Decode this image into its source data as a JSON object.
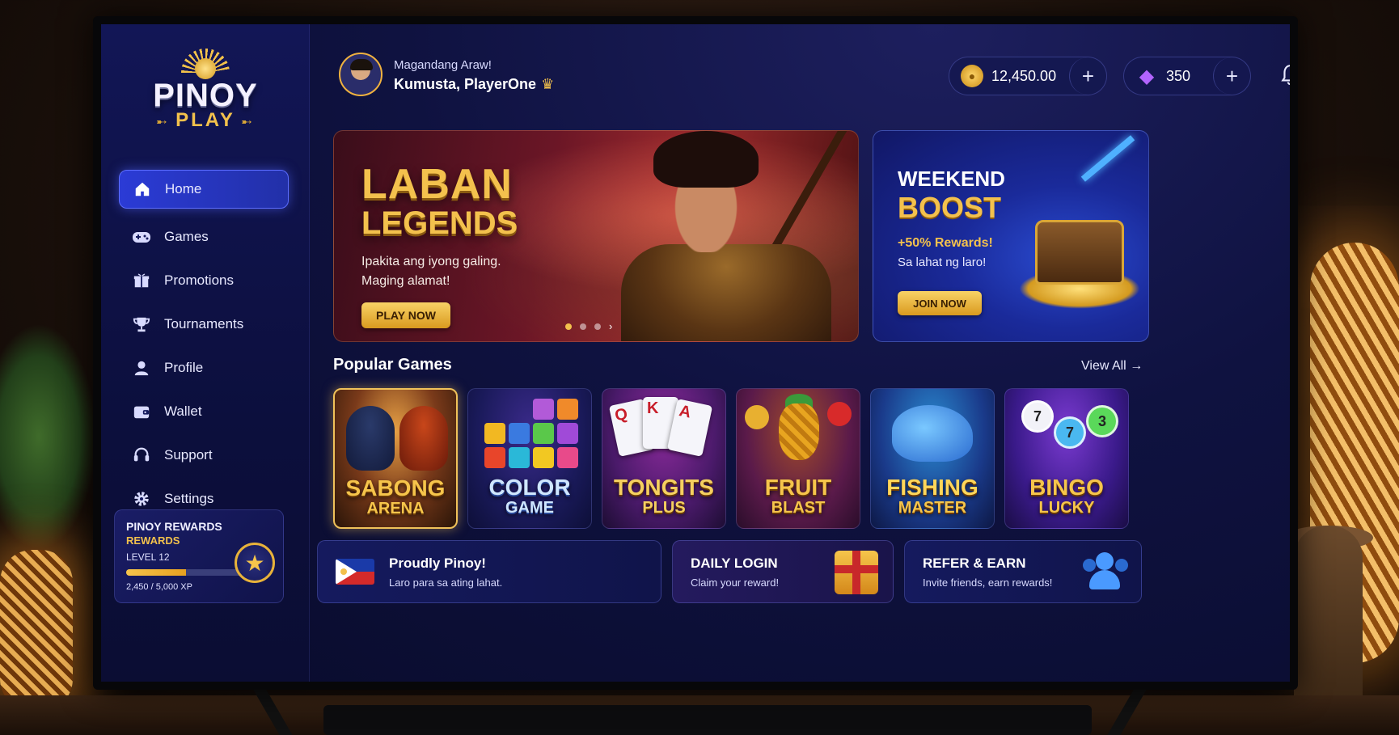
{
  "app": {
    "logo_main": "PINOY",
    "logo_sub": "PLAY"
  },
  "sidebar": {
    "items": [
      {
        "label": "Home",
        "icon": "home-icon",
        "active": true
      },
      {
        "label": "Games",
        "icon": "gamepad-icon"
      },
      {
        "label": "Promotions",
        "icon": "gift-icon"
      },
      {
        "label": "Tournaments",
        "icon": "trophy-icon"
      },
      {
        "label": "Profile",
        "icon": "user-icon"
      },
      {
        "label": "Wallet",
        "icon": "wallet-icon"
      },
      {
        "label": "Support",
        "icon": "headset-icon"
      },
      {
        "label": "Settings",
        "icon": "gear-icon"
      }
    ],
    "rewards": {
      "title": "PINOY REWARDS",
      "subtitle": "REWARDS",
      "level": "LEVEL 12",
      "xp": "2,450 / 5,000 XP",
      "progress": 0.49
    }
  },
  "header": {
    "greeting": "Magandang Araw!",
    "user_line": "Kumusta, PlayerOne",
    "coins": "12,450.00",
    "gems": "350"
  },
  "hero": {
    "title1": "LABAN",
    "title2": "LEGENDS",
    "desc1": "Ipakita ang iyong galing.",
    "desc2": "Maging alamat!",
    "button": "PLAY NOW",
    "slides": 3,
    "active_slide": 0
  },
  "boost": {
    "title1": "WEEKEND",
    "title2": "BOOST",
    "highlight": "+50% Rewards!",
    "desc": "Sa lahat ng laro!",
    "button": "JOIN NOW"
  },
  "popular": {
    "title": "Popular Games",
    "view_all": "View All",
    "games": [
      {
        "line1": "SABONG",
        "line2": "ARENA"
      },
      {
        "line1": "COLOR",
        "line2": "GAME"
      },
      {
        "line1": "TONGITS",
        "line2": "PLUS"
      },
      {
        "line1": "FRUIT",
        "line2": "BLAST"
      },
      {
        "line1": "FISHING",
        "line2": "MASTER"
      },
      {
        "line1": "BINGO",
        "line2": "LUCKY"
      }
    ]
  },
  "bottom": {
    "pinoy": {
      "title": "Proudly Pinoy!",
      "sub": "Laro para sa ating lahat."
    },
    "daily": {
      "title": "DAILY LOGIN",
      "sub": "Claim your reward!"
    },
    "refer": {
      "title": "REFER & EARN",
      "sub": "Invite friends, earn rewards!"
    }
  },
  "colors": {
    "accent_gold": "#f3c14d",
    "nav_active": "#2b3bd6",
    "screen_bg": "#0f1240"
  }
}
